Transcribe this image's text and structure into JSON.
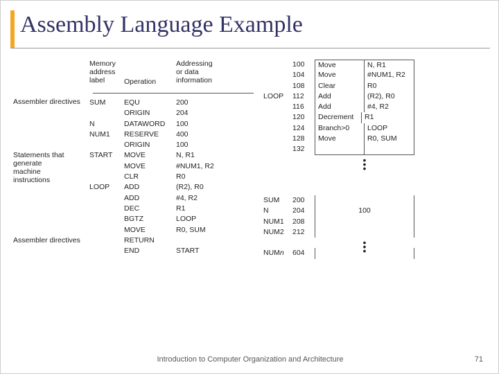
{
  "title": "Assembly Language Example",
  "left": {
    "headers": {
      "mem": "Memory\naddress\nlabel",
      "op": "Operation",
      "addr": "Addressing\nor data\ninformation"
    },
    "cat_labels": {
      "asm_dir": "Assembler directives",
      "stmts": "Statements that\ngenerate\nmachine\ninstructions",
      "asm_dir2": "Assembler directives"
    },
    "rows": [
      {
        "cat": "",
        "mem": "SUM",
        "op": "EQU",
        "addr": "200"
      },
      {
        "cat": "",
        "mem": "",
        "op": "ORIGIN",
        "addr": "204"
      },
      {
        "cat": "",
        "mem": "N",
        "op": "DATAWORD",
        "addr": "100"
      },
      {
        "cat": "",
        "mem": "NUM1",
        "op": "RESERVE",
        "addr": "400"
      },
      {
        "cat": "",
        "mem": "",
        "op": "ORIGIN",
        "addr": "100"
      },
      {
        "cat": "",
        "mem": "START",
        "op": "MOVE",
        "addr": "N, R1"
      },
      {
        "cat": "",
        "mem": "",
        "op": "MOVE",
        "addr": "#NUM1, R2"
      },
      {
        "cat": "",
        "mem": "",
        "op": "CLR",
        "addr": "R0"
      },
      {
        "cat": "",
        "mem": "LOOP",
        "op": "ADD",
        "addr": "(R2), R0"
      },
      {
        "cat": "",
        "mem": "",
        "op": "ADD",
        "addr": "#4, R2"
      },
      {
        "cat": "",
        "mem": "",
        "op": "DEC",
        "addr": "R1"
      },
      {
        "cat": "",
        "mem": "",
        "op": "BGTZ",
        "addr": "LOOP"
      },
      {
        "cat": "",
        "mem": "",
        "op": "MOVE",
        "addr": "R0, SUM"
      },
      {
        "cat": "",
        "mem": "",
        "op": "RETURN",
        "addr": ""
      },
      {
        "cat": "",
        "mem": "",
        "op": "END",
        "addr": "START"
      }
    ]
  },
  "right": {
    "code_rows": [
      {
        "lbl": "",
        "addr": "100",
        "op": "Move",
        "arg": "N, R1"
      },
      {
        "lbl": "",
        "addr": "104",
        "op": "Move",
        "arg": "#NUM1, R2"
      },
      {
        "lbl": "",
        "addr": "108",
        "op": "Clear",
        "arg": "R0"
      },
      {
        "lbl": "LOOP",
        "addr": "112",
        "op": "Add",
        "arg": "(R2), R0"
      },
      {
        "lbl": "",
        "addr": "116",
        "op": "Add",
        "arg": "#4, R2"
      },
      {
        "lbl": "",
        "addr": "120",
        "op": "Decrement",
        "arg": "R1"
      },
      {
        "lbl": "",
        "addr": "124",
        "op": "Branch>0",
        "arg": "LOOP"
      },
      {
        "lbl": "",
        "addr": "128",
        "op": "Move",
        "arg": "R0, SUM"
      },
      {
        "lbl": "",
        "addr": "132",
        "op": "",
        "arg": ""
      }
    ],
    "data_rows": [
      {
        "lbl": "SUM",
        "addr": "200",
        "val": ""
      },
      {
        "lbl": "N",
        "addr": "204",
        "val": "100"
      },
      {
        "lbl": "NUM1",
        "addr": "208",
        "val": ""
      },
      {
        "lbl": "NUM2",
        "addr": "212",
        "val": ""
      }
    ],
    "last_row": {
      "lbl": "NUMn",
      "addr": "604",
      "val": ""
    }
  },
  "footer": "Introduction to Computer Organization and Architecture",
  "page": "71"
}
